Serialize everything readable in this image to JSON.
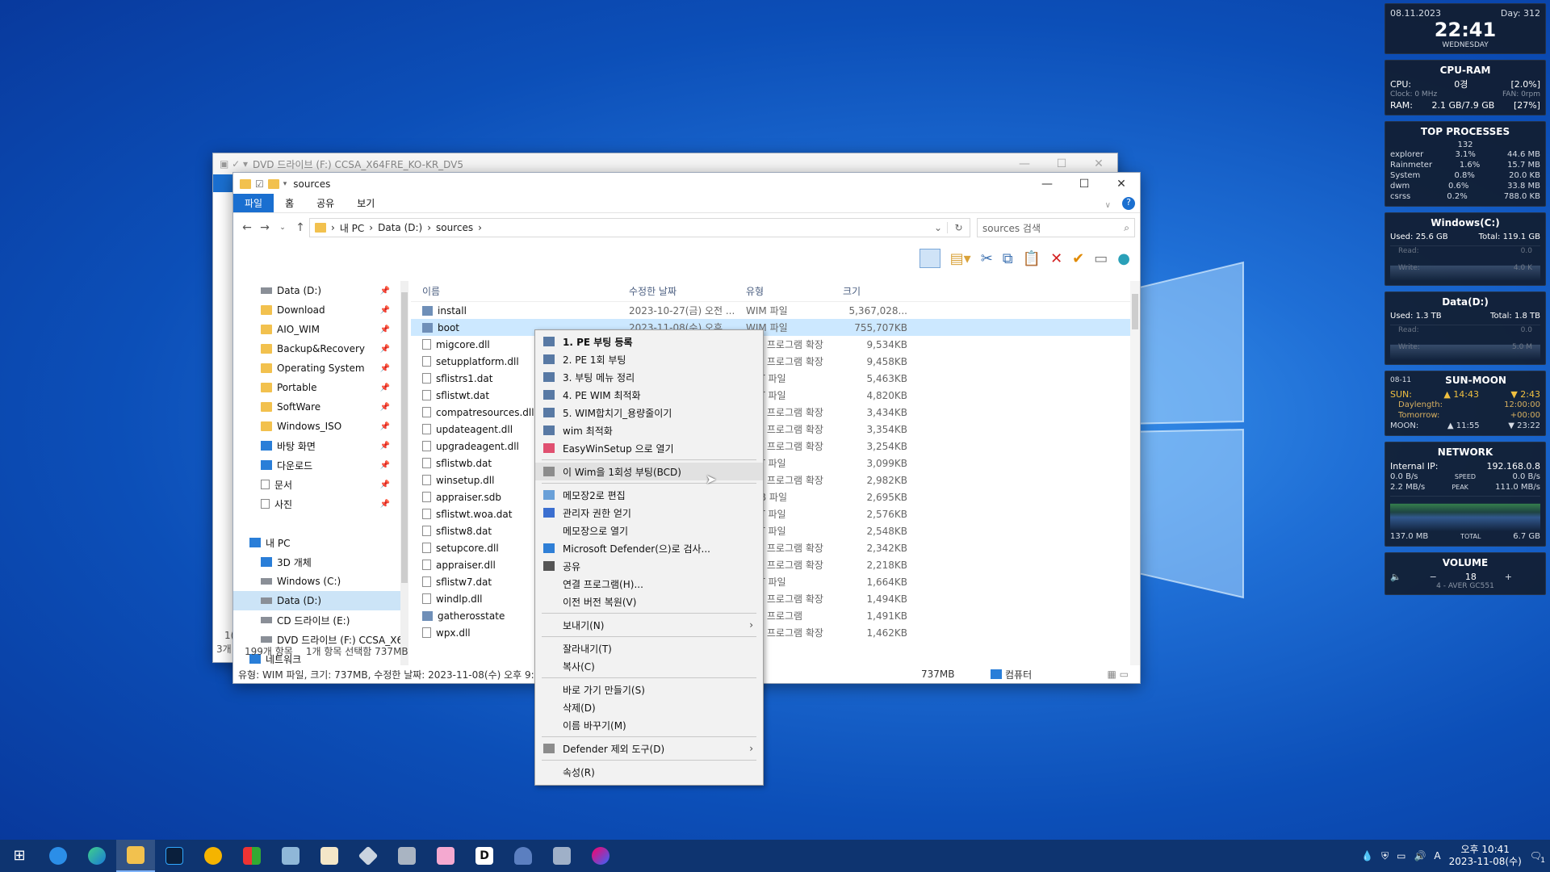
{
  "desktop": {
    "accent": "#1f6fd6"
  },
  "widgets": {
    "clock": {
      "date": "08.11.2023",
      "day": "Day: 312",
      "time": "22:41",
      "weekday": "WEDNESDAY"
    },
    "cpuram": {
      "title": "CPU-RAM",
      "cpu_label": "CPU:",
      "cpu_mid": "0경",
      "cpu_val": "[2.0%]",
      "clock": "Clock: 0 MHz",
      "fan": "FAN: 0rpm",
      "ram_label": "RAM:",
      "ram_mid": "2.1 GB/7.9 GB",
      "ram_val": "[27%]"
    },
    "top": {
      "title": "TOP PROCESSES",
      "count": "132",
      "rows": [
        {
          "name": "explorer",
          "cpu": "3.1%",
          "mem": "44.6 MB"
        },
        {
          "name": "Rainmeter",
          "cpu": "1.6%",
          "mem": "15.7 MB"
        },
        {
          "name": "System",
          "cpu": "0.8%",
          "mem": "20.0 KB"
        },
        {
          "name": "dwm",
          "cpu": "0.6%",
          "mem": "33.8 MB"
        },
        {
          "name": "csrss",
          "cpu": "0.2%",
          "mem": "788.0 KB"
        }
      ]
    },
    "winc": {
      "title": "Windows(C:)",
      "used": "Used: 25.6 GB",
      "total": "Total: 119.1 GB",
      "read": "Read:",
      "write": "Write:",
      "rv": "0.0",
      "wv": "4.0 K"
    },
    "datad": {
      "title": "Data(D:)",
      "used": "Used: 1.3 TB",
      "total": "Total: 1.8 TB",
      "read": "Read:",
      "write": "Write:",
      "rv": "0.0",
      "wv": "5.0 M"
    },
    "sunmoon": {
      "title": "SUN-MOON",
      "date": "08-11",
      "sun": "SUN:",
      "sunrise": "▲ 14:43",
      "sunset": "▼ 2:43",
      "daylength_l": "Daylength:",
      "daylength": "12:00:00",
      "tomorrow_l": "Tomorrow:",
      "tomorrow": "+00:00",
      "moon": "MOON:",
      "moonrise": "▲ 11:55",
      "moonset": "▼ 23:22"
    },
    "net": {
      "title": "NETWORK",
      "ip_l": "Internal IP:",
      "ip": "192.168.0.8",
      "up": "0.0 B/s",
      "speed": "SPEED",
      "down": "0.0 B/s",
      "up2": "2.2 MB/s",
      "peak": "PEAK",
      "down2": "111.0 MB/s",
      "tot1": "137.0 MB",
      "total": "TOTAL",
      "tot2": "6.7 GB"
    },
    "volume": {
      "title": "VOLUME",
      "minus": "−",
      "value": "18",
      "plus": "+",
      "device": "4 - AVER GC551"
    }
  },
  "backwin": {
    "title": "DVD 드라이브 (F:) CCSA_X64FRE_KO-KR_DV5",
    "status_frag": "3개",
    "num_frag": "1("
  },
  "explorer": {
    "title": "sources",
    "tabs": [
      "파일",
      "홈",
      "공유",
      "보기"
    ],
    "crumb": [
      "내 PC",
      "Data (D:)",
      "sources"
    ],
    "search_placeholder": "sources 검색",
    "nav": [
      {
        "label": "Data (D:)",
        "icon": "drive",
        "pin": true
      },
      {
        "label": "Download",
        "icon": "folder",
        "pin": true
      },
      {
        "label": "AIO_WIM",
        "icon": "folder",
        "pin": true
      },
      {
        "label": "Backup&Recovery",
        "icon": "folder",
        "pin": true
      },
      {
        "label": "Operating System",
        "icon": "folder",
        "pin": true
      },
      {
        "label": "Portable",
        "icon": "folder",
        "pin": true
      },
      {
        "label": "SoftWare",
        "icon": "folder",
        "pin": true
      },
      {
        "label": "Windows_ISO",
        "icon": "folder",
        "pin": true
      },
      {
        "label": "바탕 화면",
        "icon": "blue",
        "pin": true
      },
      {
        "label": "다운로드",
        "icon": "blue",
        "pin": true
      },
      {
        "label": "문서",
        "icon": "doc",
        "pin": true
      },
      {
        "label": "사진",
        "icon": "doc",
        "pin": true
      },
      {
        "label": "",
        "icon": "",
        "pin": false
      },
      {
        "label": "내 PC",
        "icon": "blue",
        "pin": false,
        "indent": 0
      },
      {
        "label": "3D 개체",
        "icon": "blue",
        "pin": false
      },
      {
        "label": "Windows (C:)",
        "icon": "drive",
        "pin": false
      },
      {
        "label": "Data (D:)",
        "icon": "drive",
        "pin": false,
        "sel": true
      },
      {
        "label": "CD 드라이브 (E:)",
        "icon": "drive",
        "pin": false
      },
      {
        "label": "DVD 드라이브 (F:) CCSA_X6",
        "icon": "drive",
        "pin": false
      },
      {
        "label": "네트워크",
        "icon": "blue",
        "pin": false,
        "indent": 0
      }
    ],
    "columns": [
      "이름",
      "수정한 날짜",
      "유형",
      "크기"
    ],
    "files": [
      {
        "name": "install",
        "date": "2023-10-27(금) 오전 ...",
        "type": "WIM 파일",
        "size": "5,367,028...",
        "wim": true
      },
      {
        "name": "boot",
        "date": "2023-11-08(수) 오후 ...",
        "type": "WIM 파일",
        "size": "755,707KB",
        "wim": true,
        "sel": true
      },
      {
        "name": "migcore.dll",
        "date": "",
        "type": "응용 프로그램 확장",
        "size": "9,534KB"
      },
      {
        "name": "setupplatform.dll",
        "date": "",
        "type": "응용 프로그램 확장",
        "size": "9,458KB"
      },
      {
        "name": "sflistrs1.dat",
        "date": "",
        "type": "DAT 파일",
        "size": "5,463KB"
      },
      {
        "name": "sflistwt.dat",
        "date": "",
        "type": "DAT 파일",
        "size": "4,820KB"
      },
      {
        "name": "compatresources.dll",
        "date": "",
        "type": "응용 프로그램 확장",
        "size": "3,434KB"
      },
      {
        "name": "updateagent.dll",
        "date": "",
        "type": "응용 프로그램 확장",
        "size": "3,354KB"
      },
      {
        "name": "upgradeagent.dll",
        "date": "",
        "type": "응용 프로그램 확장",
        "size": "3,254KB"
      },
      {
        "name": "sflistwb.dat",
        "date": "",
        "type": "DAT 파일",
        "size": "3,099KB"
      },
      {
        "name": "winsetup.dll",
        "date": "",
        "type": "응용 프로그램 확장",
        "size": "2,982KB"
      },
      {
        "name": "appraiser.sdb",
        "date": "",
        "type": "SDB 파일",
        "size": "2,695KB"
      },
      {
        "name": "sflistwt.woa.dat",
        "date": "",
        "type": "DAT 파일",
        "size": "2,576KB"
      },
      {
        "name": "sflistw8.dat",
        "date": "",
        "type": "DAT 파일",
        "size": "2,548KB"
      },
      {
        "name": "setupcore.dll",
        "date": "",
        "type": "응용 프로그램 확장",
        "size": "2,342KB"
      },
      {
        "name": "appraiser.dll",
        "date": "",
        "type": "응용 프로그램 확장",
        "size": "2,218KB"
      },
      {
        "name": "sflistw7.dat",
        "date": "",
        "type": "DAT 파일",
        "size": "1,664KB"
      },
      {
        "name": "windlp.dll",
        "date": "",
        "type": "응용 프로그램 확장",
        "size": "1,494KB"
      },
      {
        "name": "gatherosstate",
        "date": "",
        "type": "응용 프로그램",
        "size": "1,491KB",
        "wim": true
      },
      {
        "name": "wpx.dll",
        "date": "",
        "type": "응용 프로그램 확장",
        "size": "1,462KB"
      }
    ],
    "count": "199개 항목",
    "selected": "1개 항목 선택함 737MB",
    "status": "유형: WIM 파일, 크기: 737MB, 수정한 날짜: 2023-11-08(수) 오후 9:45",
    "status_size": "737MB",
    "status_pc": "컴퓨터"
  },
  "context_menu": [
    {
      "label": "1. PE 부팅 등록",
      "icon": "pe",
      "bold": true
    },
    {
      "label": "2. PE 1회 부팅",
      "icon": "pe"
    },
    {
      "label": "3. 부팅 메뉴 정리",
      "icon": "pe"
    },
    {
      "label": "4. PE WIM 최적화",
      "icon": "pe"
    },
    {
      "label": "5. WIM합치기_용량줄이기",
      "icon": "pe"
    },
    {
      "label": "wim 최적화",
      "icon": "pe"
    },
    {
      "label": "EasyWinSetup 으로 열기",
      "icon": "ews"
    },
    {
      "sep": true
    },
    {
      "label": "이 Wim을 1회성 부팅(BCD)",
      "icon": "gear",
      "hover": true
    },
    {
      "sep": true
    },
    {
      "label": "메모장2로 편집",
      "icon": "note"
    },
    {
      "label": "관리자 권한 얻기",
      "icon": "shield"
    },
    {
      "label": "메모장으로 열기"
    },
    {
      "label": "Microsoft Defender(으)로 검사...",
      "icon": "defender"
    },
    {
      "label": "공유",
      "icon": "share"
    },
    {
      "label": "연결 프로그램(H)..."
    },
    {
      "label": "이전 버전 복원(V)"
    },
    {
      "sep": true
    },
    {
      "label": "보내기(N)",
      "arrow": true
    },
    {
      "sep": true
    },
    {
      "label": "잘라내기(T)"
    },
    {
      "label": "복사(C)"
    },
    {
      "sep": true
    },
    {
      "label": "바로 가기 만들기(S)"
    },
    {
      "label": "삭제(D)"
    },
    {
      "label": "이름 바꾸기(M)"
    },
    {
      "sep": true
    },
    {
      "label": "Defender 제외 도구(D)",
      "icon": "gear",
      "arrow": true
    },
    {
      "sep": true
    },
    {
      "label": "속성(R)"
    }
  ],
  "taskbar": {
    "time": "오후 10:41",
    "date": "2023-11-08(수)",
    "ime": "A",
    "notif": "1"
  }
}
